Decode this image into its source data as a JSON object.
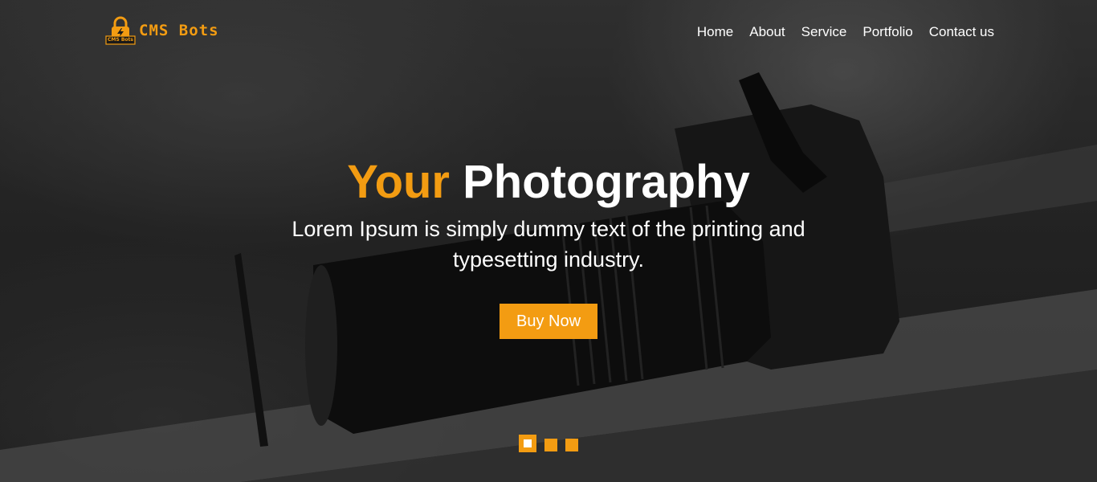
{
  "brand": {
    "badge_text": "CMS Bots",
    "name": "CMS Bots",
    "accent_color": "#f39c12"
  },
  "nav": {
    "items": [
      {
        "label": "Home"
      },
      {
        "label": "About"
      },
      {
        "label": "Service"
      },
      {
        "label": "Portfolio"
      },
      {
        "label": "Contact us"
      }
    ]
  },
  "hero": {
    "title_accent": "Your",
    "title_rest": "Photography",
    "subtitle": "Lorem Ipsum is simply dummy text of the printing and typesetting industry.",
    "cta_label": "Buy Now",
    "background_image": "black-and-white camera with zoom lens on wooden rail",
    "slides": {
      "count": 3,
      "active": 1
    }
  }
}
